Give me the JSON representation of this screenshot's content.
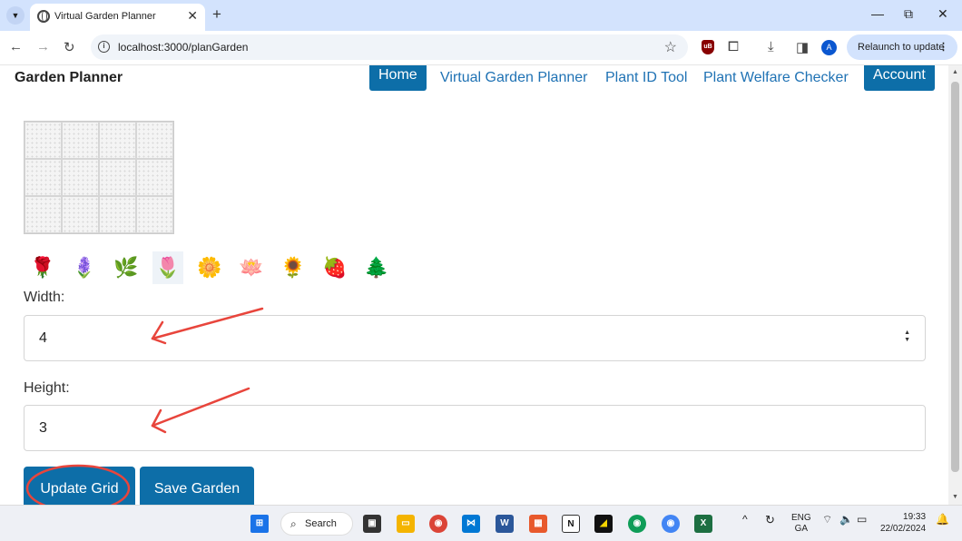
{
  "browser": {
    "tab_title": "Virtual Garden Planner",
    "url": "localhost:3000/planGarden",
    "relaunch_label": "Relaunch to update",
    "profile_initial": "A"
  },
  "nav": {
    "brand": "Garden Planner",
    "home": "Home",
    "virtual_garden_planner": "Virtual Garden Planner",
    "plant_id_tool": "Plant ID Tool",
    "plant_welfare_checker": "Plant Welfare Checker",
    "account": "Account"
  },
  "grid": {
    "columns": 4,
    "rows": 3
  },
  "plants": [
    {
      "name": "rose",
      "glyph": "🌹"
    },
    {
      "name": "lavender",
      "glyph": "🪻"
    },
    {
      "name": "basil",
      "glyph": "🌿"
    },
    {
      "name": "tulip",
      "glyph": "🌷"
    },
    {
      "name": "daisy",
      "glyph": "🌼"
    },
    {
      "name": "orchid",
      "glyph": "🪷"
    },
    {
      "name": "sunflower",
      "glyph": "🌻"
    },
    {
      "name": "strawberry",
      "glyph": "🍓"
    },
    {
      "name": "fern",
      "glyph": "🌲"
    }
  ],
  "form": {
    "width_label": "Width:",
    "width_value": "4",
    "height_label": "Height:",
    "height_value": "3",
    "update_button": "Update Grid",
    "save_button": "Save Garden"
  },
  "annotation_color": "#e8453c",
  "accent_color": "#0d6ea8",
  "taskbar": {
    "search_label": "Search",
    "lang_top": "ENG",
    "lang_bottom": "GA",
    "time": "19:33",
    "date": "22/02/2024"
  }
}
